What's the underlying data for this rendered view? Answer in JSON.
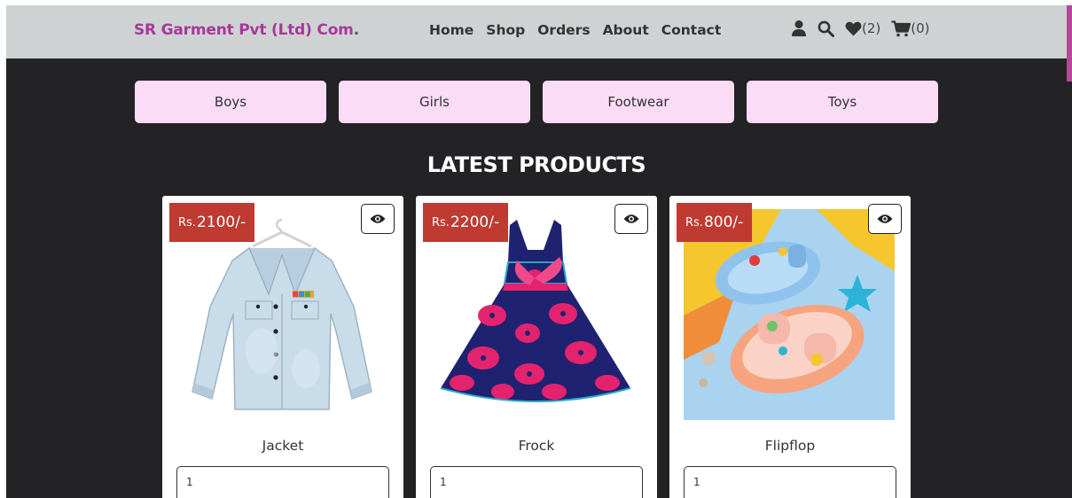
{
  "navbar": {
    "brand": "SR Garment Pvt (Ltd) Com",
    "brand_dot": ".",
    "links": [
      "Home",
      "Shop",
      "Orders",
      "About",
      "Contact"
    ],
    "wishlist_count": "(2)",
    "cart_count": "(0)",
    "icons": [
      "user-icon",
      "search-icon",
      "heart-icon",
      "cart-icon"
    ]
  },
  "categories": [
    "Boys",
    "Girls",
    "Footwear",
    "Toys"
  ],
  "section_title": "LATEST PRODUCTS",
  "products": [
    {
      "currency": "Rs.",
      "price": "2100/-",
      "name": "Jacket",
      "qty": "1"
    },
    {
      "currency": "Rs.",
      "price": "2200/-",
      "name": "Frock",
      "qty": "1"
    },
    {
      "currency": "Rs.",
      "price": "800/-",
      "name": "Flipflop",
      "qty": "1"
    }
  ],
  "colors": {
    "brand": "#a8379b",
    "navbar": "#cfd2d3",
    "page_bg": "#232225",
    "category_bg": "#fbdcf6",
    "price_tag": "#bf3a31"
  }
}
